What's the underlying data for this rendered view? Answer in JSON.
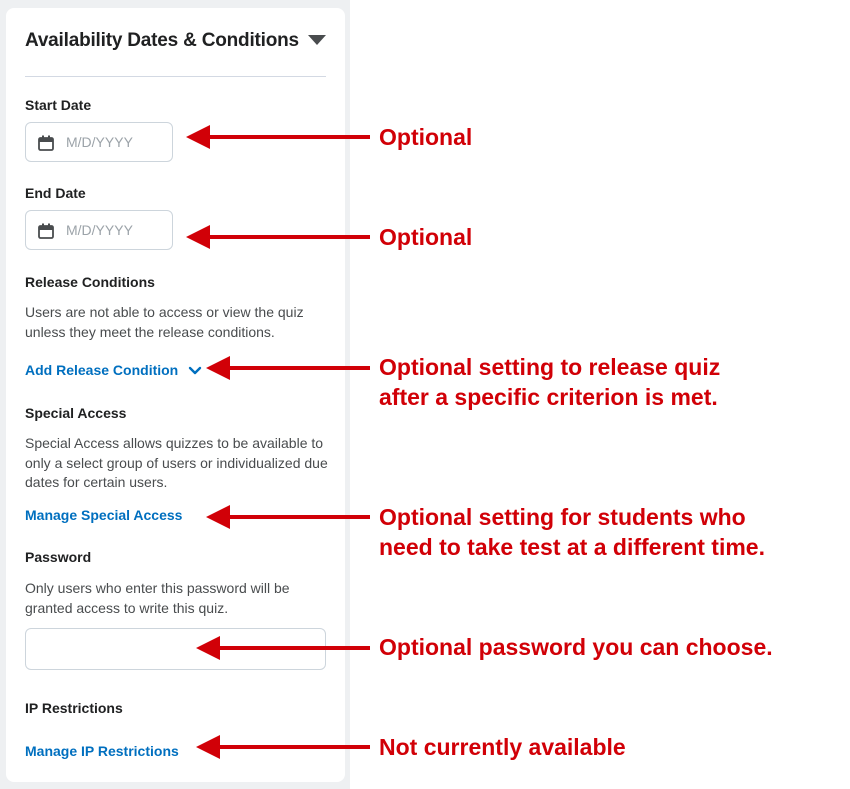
{
  "panel": {
    "title": "Availability Dates & Conditions",
    "start_date": {
      "label": "Start Date",
      "placeholder": "M/D/YYYY"
    },
    "end_date": {
      "label": "End Date",
      "placeholder": "M/D/YYYY"
    },
    "release_conditions": {
      "label": "Release Conditions",
      "description": "Users are not able to access or view the quiz unless they meet the release conditions.",
      "link": "Add Release Condition"
    },
    "special_access": {
      "label": "Special Access",
      "description": "Special Access allows quizzes to be available to only a select group of users or individualized due dates for certain users.",
      "link": "Manage Special Access"
    },
    "password": {
      "label": "Password",
      "description": "Only users who enter this password will be granted access to write this quiz.",
      "value": ""
    },
    "ip_restrictions": {
      "label": "IP Restrictions",
      "link": "Manage IP Restrictions"
    }
  },
  "annotations": {
    "start_date": "Optional",
    "end_date": "Optional",
    "release_line1": "Optional setting to release quiz",
    "release_line2": "after a specific criterion is met.",
    "special_line1": "Optional setting for students who",
    "special_line2": "need to take test at a different time.",
    "password": "Optional password you can choose.",
    "ip": "Not currently available"
  },
  "colors": {
    "annotation_red": "#d10007",
    "link_blue": "#006fbf",
    "panel_bg": "#eef0f2"
  },
  "icons": [
    "calendar-icon",
    "chevron-down-icon",
    "caret-down-icon",
    "arrow-left-icon"
  ]
}
